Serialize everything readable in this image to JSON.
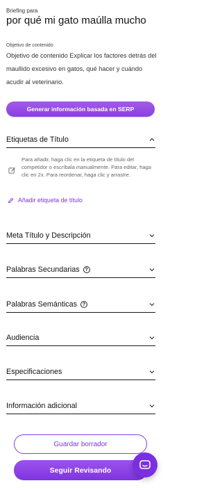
{
  "header": {
    "kicker": "Briefing para",
    "title": "por qué mi gato maúlla mucho",
    "objective_label": "Objetivo de contenido",
    "objective_text": "Objetivo de contenido Explicar los factores detrás del maullido excesivo en gatos, qué hacer y cuándo acudir al veterinario."
  },
  "serp_button": {
    "label": "Generar información basada en SERP"
  },
  "sections": {
    "etiquetas": {
      "title": "Etiquetas de Título",
      "hint": "Para añadir, haga clic en la etiqueta de título del competidor o escríbala manualmente. Para editar, haga clic en 2x. Para reordenar, haga clic y arrastre.",
      "add_label": "Añadir etiqueta de título"
    },
    "meta": {
      "title": "Meta Título y Descripción"
    },
    "secundarias": {
      "title": "Palabras Secundarias",
      "help": "?"
    },
    "semanticas": {
      "title": "Palabras Semánticas",
      "help": "?"
    },
    "audiencia": {
      "title": "Audiencia"
    },
    "especificaciones": {
      "title": "Especificaciones"
    },
    "adicional": {
      "title": "Información adicional"
    }
  },
  "actions": {
    "draft_label": "Guardar borrador",
    "review_label": "Seguir Revisando"
  },
  "colors": {
    "accent": "#8a3fe0",
    "text": "#111111",
    "muted": "#666666"
  }
}
